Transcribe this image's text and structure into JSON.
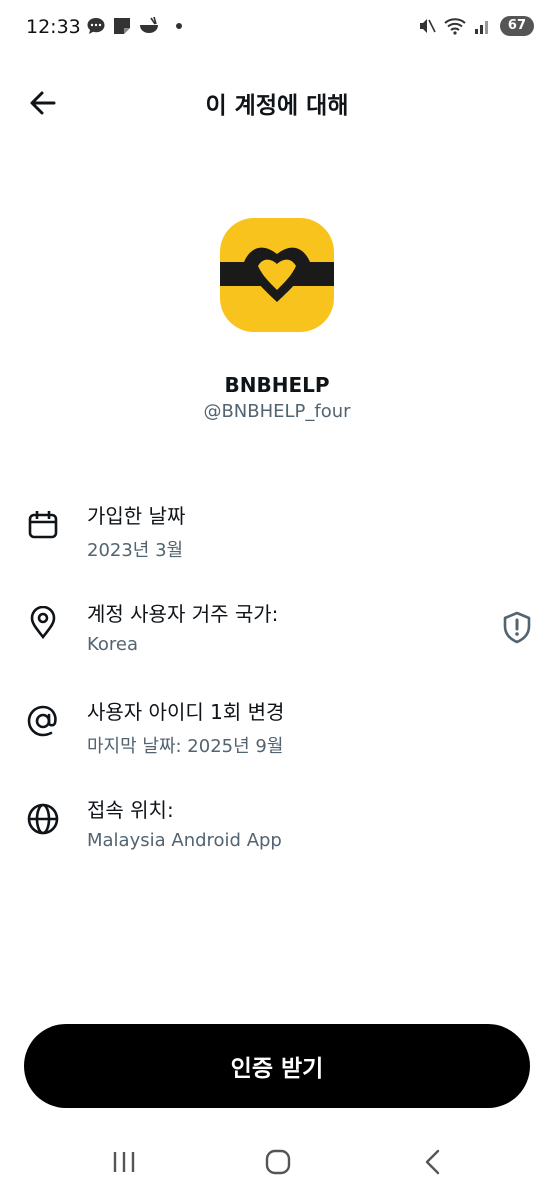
{
  "status_bar": {
    "time": "12:33",
    "battery": "67"
  },
  "header": {
    "title": "이 계정에 대해"
  },
  "profile": {
    "name": "BNBHELP",
    "handle": "@BNBHELP_four",
    "avatar_color": "#f9c31d"
  },
  "info": [
    {
      "icon": "calendar-icon",
      "title": "가입한 날짜",
      "value": "2023년 3월"
    },
    {
      "icon": "location-pin-icon",
      "title": "계정 사용자 거주 국가:",
      "value": "Korea"
    },
    {
      "icon": "at-sign-icon",
      "title": "사용자 아이디 1회 변경",
      "value": "마지막 날짜: 2025년 9월"
    },
    {
      "icon": "globe-icon",
      "title": "접속 위치:",
      "value": "Malaysia Android App"
    }
  ],
  "cta": {
    "label": "인증 받기"
  },
  "colors": {
    "text": "#0f1419",
    "secondary": "#536471",
    "button": "#000000"
  }
}
